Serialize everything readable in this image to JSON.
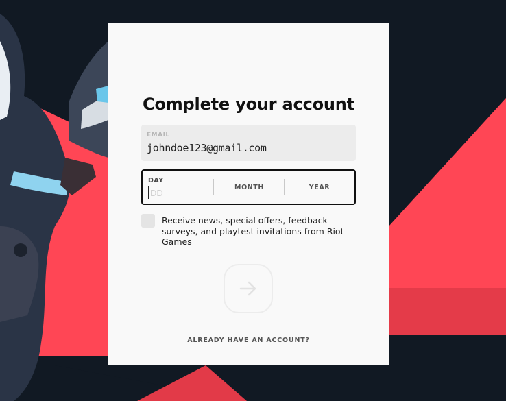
{
  "form": {
    "title": "Complete your account",
    "email": {
      "label": "EMAIL",
      "value": "johndoe123@gmail.com"
    },
    "dob": {
      "day_label": "DAY",
      "day_placeholder": "DD",
      "month_label": "MONTH",
      "year_label": "YEAR"
    },
    "consent": {
      "label": "Receive news, special offers, feedback surveys, and playtest invitations from Riot Games",
      "checked": false
    },
    "submit": {
      "icon": "arrow-right-icon",
      "enabled": false
    },
    "footer_link": "ALREADY HAVE AN ACCOUNT?"
  },
  "colors": {
    "background": "#111923",
    "accent_red": "#ff4655",
    "card": "#f9f9f9"
  }
}
